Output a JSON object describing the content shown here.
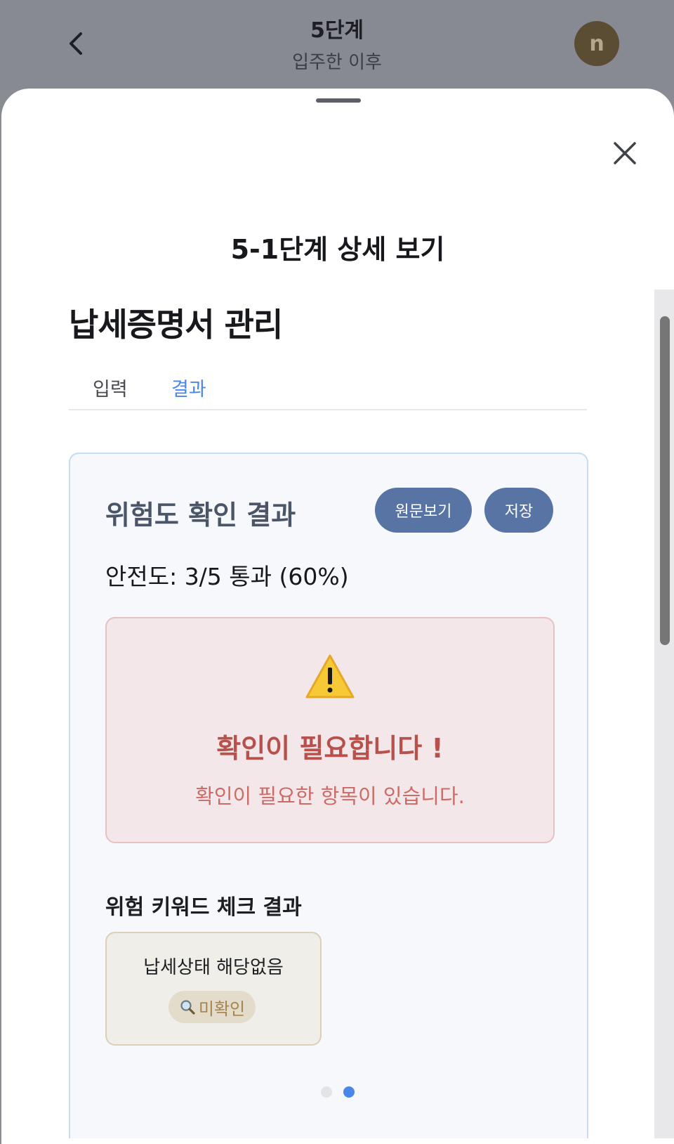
{
  "header": {
    "title": "5단계",
    "subtitle": "입주한 이후",
    "avatar_initial": "n"
  },
  "sheet": {
    "title": "5-1단계 상세 보기",
    "section_title": "납세증명서 관리",
    "tabs": [
      {
        "label": "입력",
        "active": false
      },
      {
        "label": "결과",
        "active": true
      }
    ],
    "result": {
      "heading": "위험도 확인 결과",
      "view_original_label": "원문보기",
      "save_label": "저장",
      "safety_text": "안전도: 3/5 통과 (60%)",
      "alert_title": "확인이 필요합니다 !",
      "alert_description": "확인이 필요한 항목이 있습니다.",
      "keyword_heading": "위험 키워드 체크 결과",
      "keywords": [
        {
          "label": "납세상태 해당없음",
          "status": "미확인",
          "icon": "magnifier-icon"
        }
      ]
    },
    "pagination": {
      "pages": 2,
      "current": 2
    }
  },
  "colors": {
    "accent": "#4b87e8",
    "button": "#5774a4",
    "alert_text": "#b8504b",
    "alert_bg": "#f3e7ea"
  }
}
